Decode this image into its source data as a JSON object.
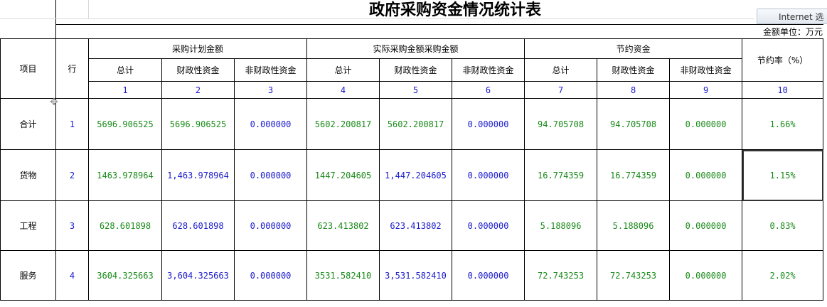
{
  "title": "政府采购资金情况统计表",
  "browser_tab": "Internet 选",
  "unit": "金额单位：万元",
  "headers": {
    "item": "项目",
    "row": "行",
    "group1": "采购计划金额",
    "group2": "实际采购金额采购金额",
    "group3": "节约资金",
    "rate": "节约率（%）",
    "sub": [
      "总计",
      "财政性资金",
      "非财政性资金",
      "总计",
      "财政性资金",
      "非财政性资金",
      "总计",
      "财政性资金",
      "非财政性资金"
    ],
    "nums": [
      "1",
      "2",
      "3",
      "4",
      "5",
      "6",
      "7",
      "8",
      "9",
      "10"
    ]
  },
  "rows": [
    {
      "label": "合计",
      "no": "1",
      "cells": [
        "5696.906525",
        "5696.906525",
        "0.000000",
        "5602.200817",
        "5602.200817",
        "0.000000",
        "94.705708",
        "94.705708",
        "0.000000"
      ],
      "rate": "1.66%"
    },
    {
      "label": "货物",
      "no": "2",
      "cells": [
        "1463.978964",
        "1,463.978964",
        "0.000000",
        "1447.204605",
        "1,447.204605",
        "0.000000",
        "16.774359",
        "16.774359",
        "0.000000"
      ],
      "rate": "1.15%"
    },
    {
      "label": "工程",
      "no": "3",
      "cells": [
        "628.601898",
        "628.601898",
        "0.000000",
        "623.413802",
        "623.413802",
        "0.000000",
        "5.188096",
        "5.188096",
        "0.000000"
      ],
      "rate": "0.83%"
    },
    {
      "label": "服务",
      "no": "4",
      "cells": [
        "3604.325663",
        "3,604.325663",
        "0.000000",
        "3531.582410",
        "3,531.582410",
        "0.000000",
        "72.743253",
        "72.743253",
        "0.000000"
      ],
      "rate": "2.02%"
    }
  ],
  "colors": {
    "green": "#1a8a1a",
    "blue": "#1a1acc"
  }
}
